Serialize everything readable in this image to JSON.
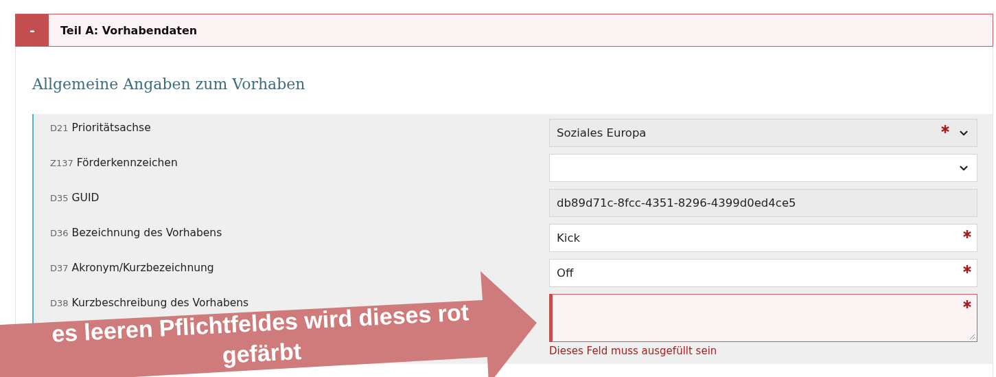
{
  "section": {
    "toggle": "-",
    "title": "Teil A: Vorhabendaten",
    "expanded": true
  },
  "group_title": "Allgemeine Angaben zum Vorhaben",
  "fields": [
    {
      "code": "D21",
      "label": "Prioritätsachse",
      "kind": "select",
      "value": "Soziales Europa",
      "required": true,
      "readonly": true,
      "error": false
    },
    {
      "code": "Z137",
      "label": "Förderkennzeichen",
      "kind": "select",
      "required": false,
      "readonly": false,
      "error": false
    },
    {
      "code": "D35",
      "label": "GUID",
      "kind": "text",
      "value": "db89d71c-8fcc-4351-8296-4399d0ed4ce5",
      "required": false,
      "readonly": true,
      "error": false
    },
    {
      "code": "D36",
      "label": "Bezeichnung des Vorhabens",
      "kind": "text",
      "value": "Kick",
      "required": true,
      "readonly": false,
      "error": false
    },
    {
      "code": "D37",
      "label": "Akronym/Kurzbezeichnung",
      "kind": "text",
      "value": "Off",
      "required": true,
      "readonly": false,
      "error": false
    },
    {
      "code": "D38",
      "label": "Kurzbeschreibung des Vorhabens",
      "kind": "textarea",
      "required": true,
      "readonly": false,
      "error": true,
      "error_message": "Dieses Feld muss ausgefüllt sein"
    }
  ],
  "callout": {
    "lines": [
      "es leeren Pflichtfeldes wird dieses rot",
      "gefärbt"
    ]
  }
}
